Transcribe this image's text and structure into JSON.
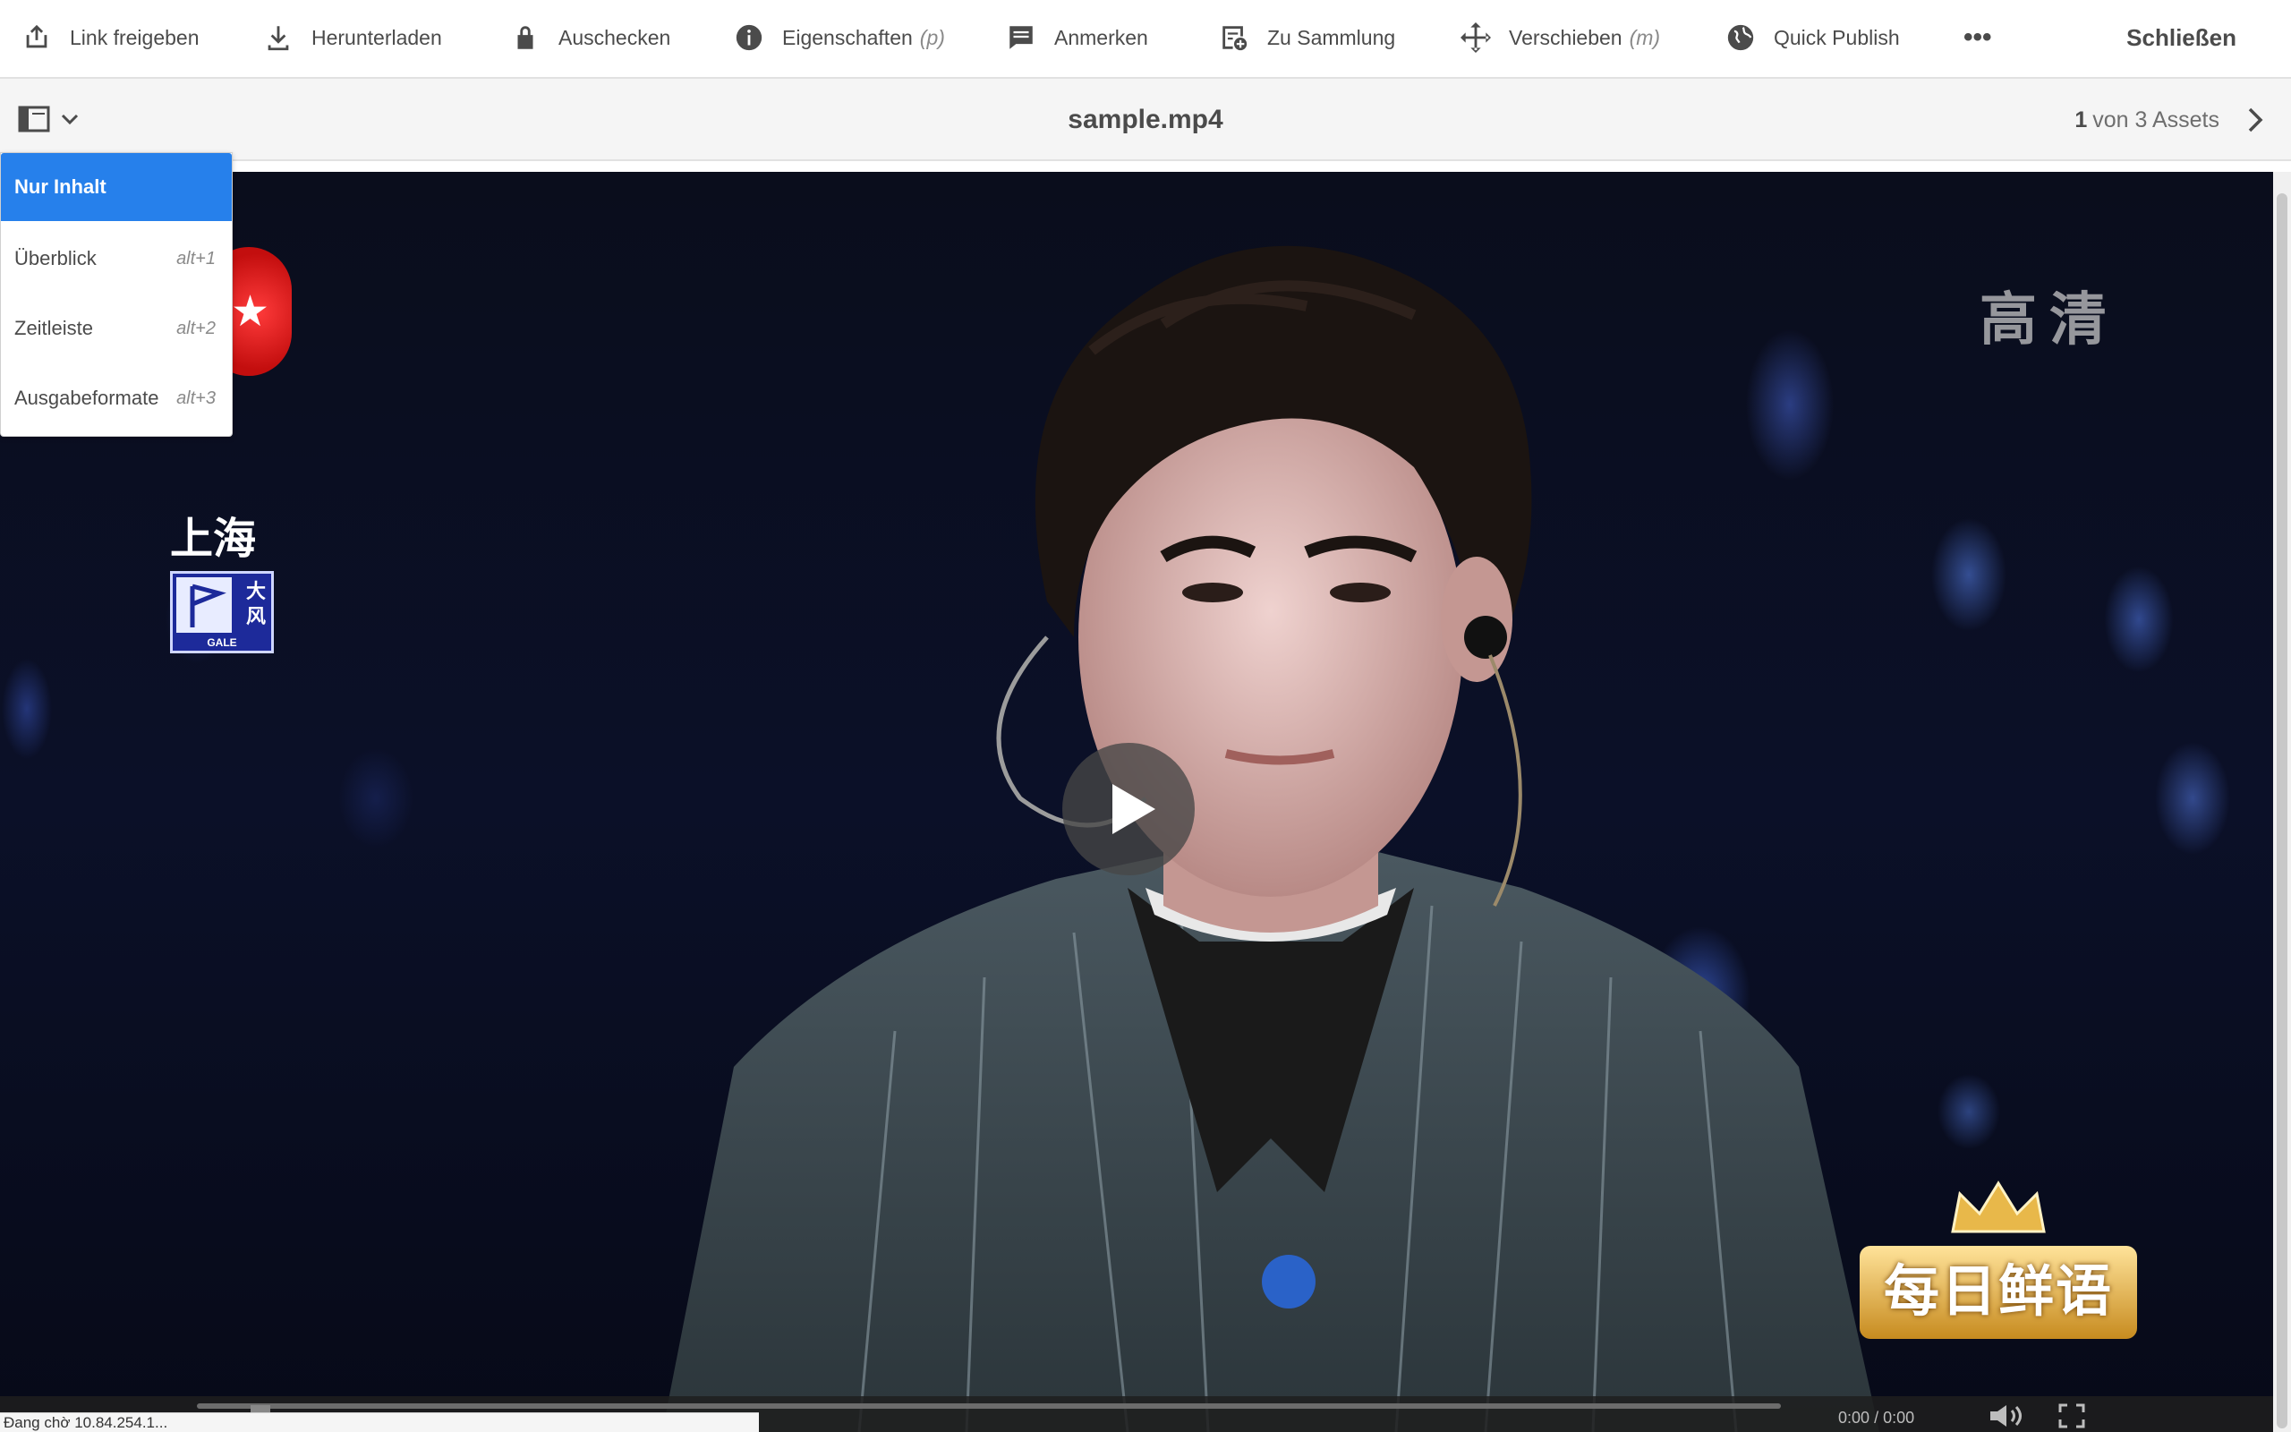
{
  "toolbar": {
    "link_share": "Link freigeben",
    "download": "Herunterladen",
    "checkout": "Auschecken",
    "properties": "Eigenschaften",
    "properties_key": "(p)",
    "annotate": "Anmerken",
    "to_collection": "Zu Sammlung",
    "move": "Verschieben",
    "move_key": "(m)",
    "quick_publish": "Quick Publish",
    "more": "•••",
    "close": "Schließen"
  },
  "titlebar": {
    "file_name": "sample.mp4",
    "pager_current": "1",
    "pager_rest": "von 3 Assets"
  },
  "rail_menu": {
    "items": [
      {
        "label": "Nur Inhalt",
        "shortcut": "",
        "active": true
      },
      {
        "label": "Überblick",
        "shortcut": "alt+1",
        "active": false
      },
      {
        "label": "Zeitleiste",
        "shortcut": "alt+2",
        "active": false
      },
      {
        "label": "Ausgabeformate",
        "shortcut": "alt+3",
        "active": false
      }
    ]
  },
  "video": {
    "overlay_hd": "高清",
    "overlay_city": "上海",
    "warning_char_1": "大",
    "warning_char_2": "风",
    "warning_code": "GALE",
    "brand_text": "每日鲜语",
    "time_current": "0:00",
    "time_separator": "/",
    "time_total": "0:00",
    "progress": 0
  },
  "status_bar": {
    "text": "Đang chờ 10.84.254.1..."
  },
  "colors": {
    "accent": "#2680eb",
    "text": "#4b4b4b",
    "muted": "#8a8a8a"
  }
}
